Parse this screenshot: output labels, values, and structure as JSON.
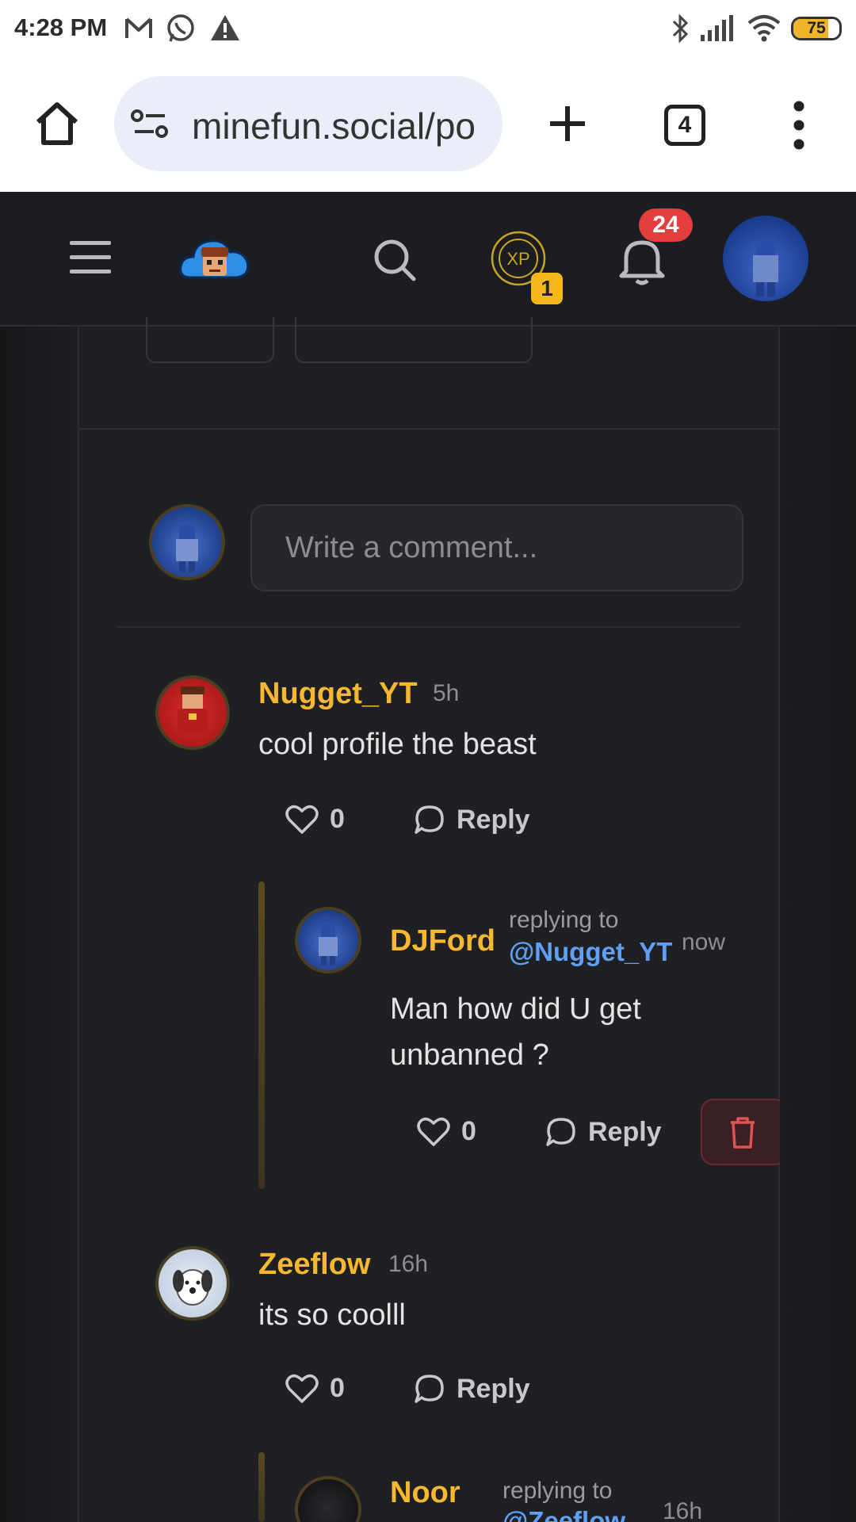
{
  "status_bar": {
    "time": "4:28 PM",
    "battery_level": "75",
    "icons": [
      "gmail-icon",
      "whatsapp-icon",
      "alert-icon",
      "bluetooth-icon",
      "signal-icon",
      "wifi-icon",
      "battery-icon"
    ]
  },
  "browser": {
    "url": "minefun.social/po",
    "tab_count": "4",
    "icons": [
      "home-icon",
      "site-info-icon",
      "new-tab-icon",
      "tabs-icon",
      "menu-icon"
    ]
  },
  "app_header": {
    "xp_label": "XP",
    "xp_level": "1",
    "notification_count": "24",
    "accent": "#f5b82e"
  },
  "composer": {
    "placeholder": "Write a comment..."
  },
  "comments": [
    {
      "author": "Nugget_YT",
      "time": "5h",
      "text": "cool profile the beast",
      "likes": "0",
      "reply_label": "Reply",
      "replies": [
        {
          "author": "DJFord",
          "replying_to_label": "replying to",
          "replying_to": "@Nugget_YT",
          "time": "now",
          "text_line1": "Man how did U get",
          "text_line2": "unbanned ?",
          "likes": "0",
          "reply_label": "Reply"
        }
      ]
    },
    {
      "author": "Zeeflow",
      "time": "16h",
      "text": "its so coolll",
      "likes": "0",
      "reply_label": "Reply",
      "replies": [
        {
          "author": "Noor",
          "replying_to_label": "replying to",
          "replying_to": "@Zeeflow",
          "time": "16h"
        }
      ]
    }
  ],
  "colors": {
    "username": "#f5b82e",
    "mention": "#5fa0f5",
    "background": "#1f2024",
    "danger": "#e05252"
  }
}
